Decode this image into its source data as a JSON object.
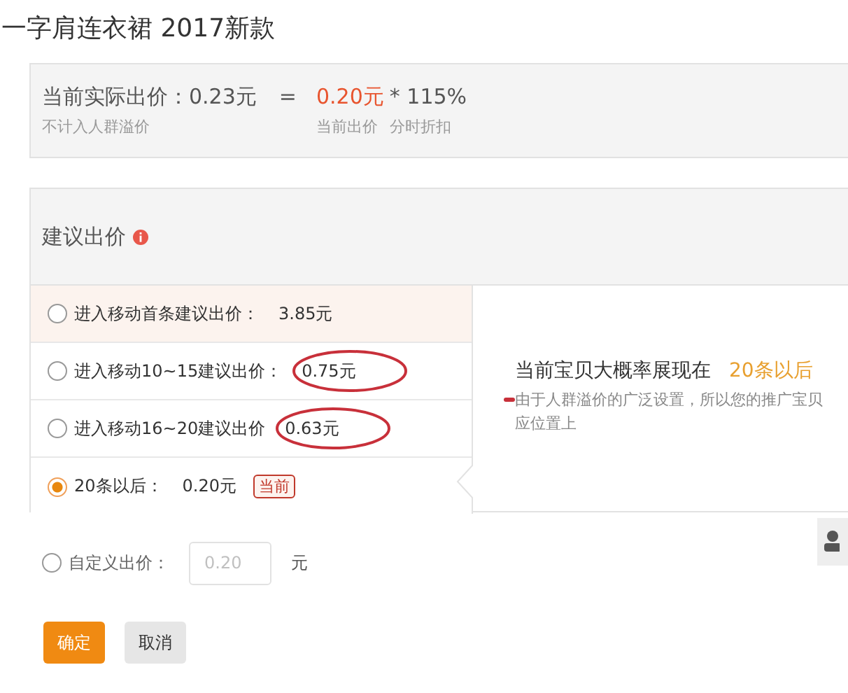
{
  "title": "一字肩连衣裙 2017新款",
  "summary": {
    "actual_label": "当前实际出价：0.23元",
    "equals": "=",
    "bid": "0.20元",
    "multiplier": "* 115%",
    "actual_note": "不计入人群溢价",
    "bid_note": "当前出价",
    "multiplier_note": "分时折扣"
  },
  "suggest": {
    "title": "建议出价",
    "options": [
      {
        "label": "进入移动首条建议出价：",
        "value": "3.85元",
        "selected": false,
        "highlighted": true,
        "circled": false
      },
      {
        "label": "进入移动10~15建议出价：",
        "value": "0.75元",
        "selected": false,
        "highlighted": false,
        "circled": true
      },
      {
        "label": "进入移动16~20建议出价",
        "value": "0.63元",
        "selected": false,
        "highlighted": false,
        "circled": true
      },
      {
        "label": "20条以后：",
        "value": "0.20元",
        "badge": "当前",
        "selected": true,
        "highlighted": false,
        "circled": false
      }
    ],
    "result_label": "当前宝贝大概率展现在",
    "result_value": "20条以后",
    "description_lines": [
      "由于人群溢价的广泛设置，所以您的推广宝贝",
      "应位置上"
    ]
  },
  "custom": {
    "label": "自定义出价：",
    "placeholder": "0.20",
    "unit": "元",
    "selected": false
  },
  "buttons": [
    {
      "label": "确定",
      "kind": "primary"
    },
    {
      "label": "取消",
      "kind": "secondary"
    }
  ]
}
